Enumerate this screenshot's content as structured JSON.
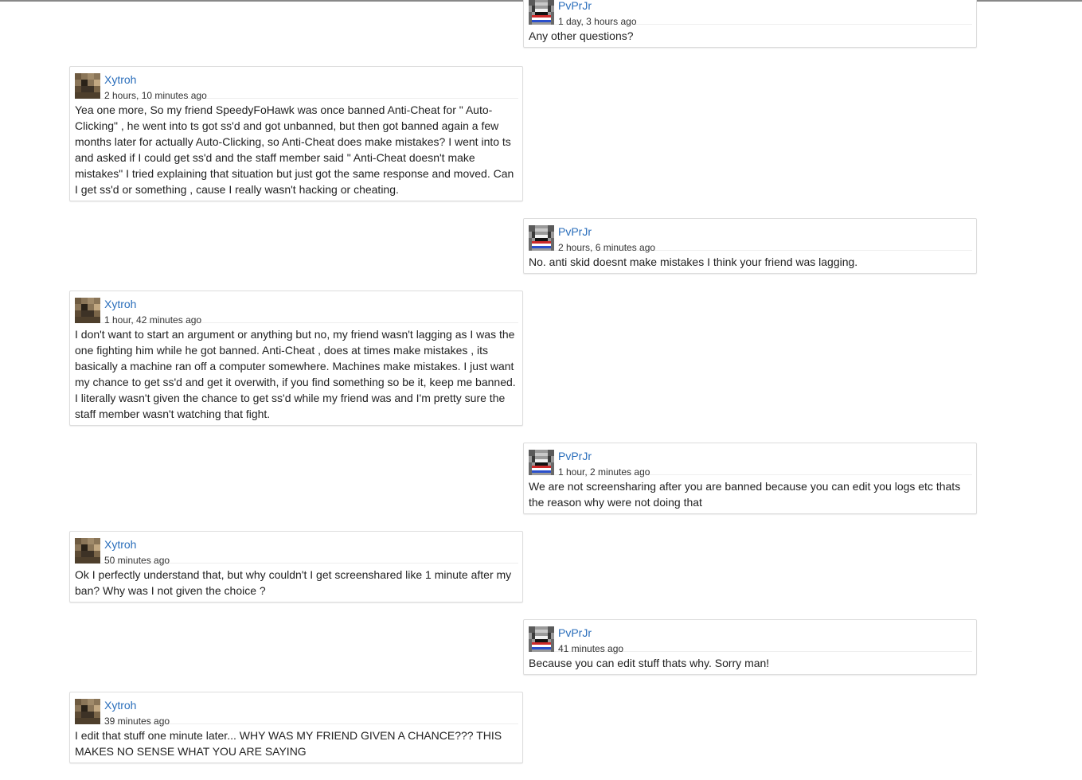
{
  "thread": {
    "posts": [
      {
        "author": "PvPrJr",
        "time": "1 day, 3 hours ago",
        "text": "Any other questions?",
        "avatar": "pvprjr-avatar"
      },
      {
        "author": "Xytroh",
        "time": "2 hours, 10 minutes ago",
        "text": "Yea one more, So my friend SpeedyFoHawk was once banned Anti-Cheat for \" Auto-Clicking\" , he went into ts got ss'd and got unbanned, but then got banned again a few months later for actually Auto-Clicking, so Anti-Cheat does make mistakes? I went into ts and asked if I could get ss'd and the staff member said \" Anti-Cheat doesn't make mistakes\" I tried explaining that situation but just got the same response and moved. Can I get ss'd or something , cause I really wasn't hacking or cheating.",
        "avatar": "xytroh-avatar"
      },
      {
        "author": "PvPrJr",
        "time": "2 hours, 6 minutes ago",
        "text": "No. anti skid doesnt make mistakes I think your friend was lagging.",
        "avatar": "pvprjr-avatar"
      },
      {
        "author": "Xytroh",
        "time": "1 hour, 42 minutes ago",
        "text": "I don't want to start an argument or anything but no, my friend wasn't lagging as I was the one fighting him while he got banned. Anti-Cheat , does at times make mistakes , its basically a machine ran off a computer somewhere. Machines make mistakes. I just want my chance to get ss'd and get it overwith, if you find something so be it, keep me banned. I literally wasn't given the chance to get ss'd while my friend was and I'm pretty sure the staff member wasn't watching that fight.",
        "avatar": "xytroh-avatar"
      },
      {
        "author": "PvPrJr",
        "time": "1 hour, 2 minutes ago",
        "text": "We are not screensharing after you are banned because you can edit you logs etc thats the reason why were not doing that",
        "avatar": "pvprjr-avatar"
      },
      {
        "author": "Xytroh",
        "time": "50 minutes ago",
        "text": "Ok I perfectly understand that, but why couldn't I get screenshared like 1 minute after my ban? Why was I not given the choice ?",
        "avatar": "xytroh-avatar"
      },
      {
        "author": "PvPrJr",
        "time": "41 minutes ago",
        "text": "Because you can edit stuff thats why. Sorry man!",
        "avatar": "pvprjr-avatar"
      },
      {
        "author": "Xytroh",
        "time": "39 minutes ago",
        "text": "I edit that stuff one minute later... WHY WAS MY FRIEND GIVEN A CHANCE??? THIS MAKES NO SENSE WHAT YOU ARE SAYING",
        "avatar": "xytroh-avatar"
      }
    ]
  },
  "colors": {
    "link": "#2a6ebb",
    "border": "#dddddd",
    "text": "#222222"
  }
}
